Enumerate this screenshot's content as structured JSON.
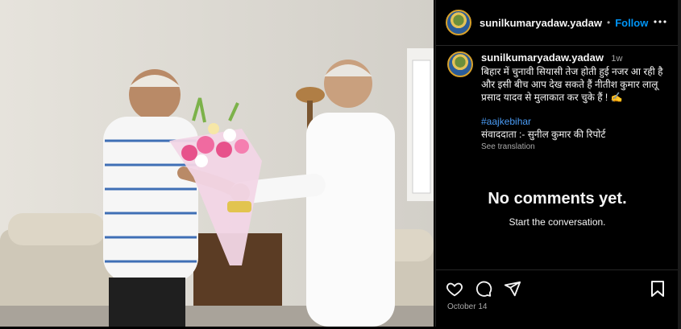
{
  "post": {
    "username": "sunilkumaryadaw.yadaw",
    "follow_label": "Follow",
    "separator": "•",
    "caption": {
      "username": "sunilkumaryadaw.yadaw",
      "time_ago": "1w",
      "text": "बिहार में चुनावी सियासी तेज होती हुई नजर आ रही है और इसी बीच आप देख सकते हैं नीतीश कुमार लालू प्रसाद यादव से मुलाकात कर चुके हैं ! ✍️",
      "hashtag": "#aajkebihar",
      "reporter_line": "संवाददाता :- सुनील कुमार की रिपोर्ट",
      "see_translation": "See translation"
    },
    "comments_empty": {
      "title": "No comments yet.",
      "subtitle": "Start the conversation."
    },
    "date": "October 14"
  },
  "icons": [
    "more-icon",
    "heart-icon",
    "comment-icon",
    "share-icon",
    "bookmark-icon"
  ],
  "colors": {
    "background": "#000000",
    "link": "#0095f6",
    "hashtag": "#4a9cf6",
    "muted": "#a8a8a8"
  }
}
